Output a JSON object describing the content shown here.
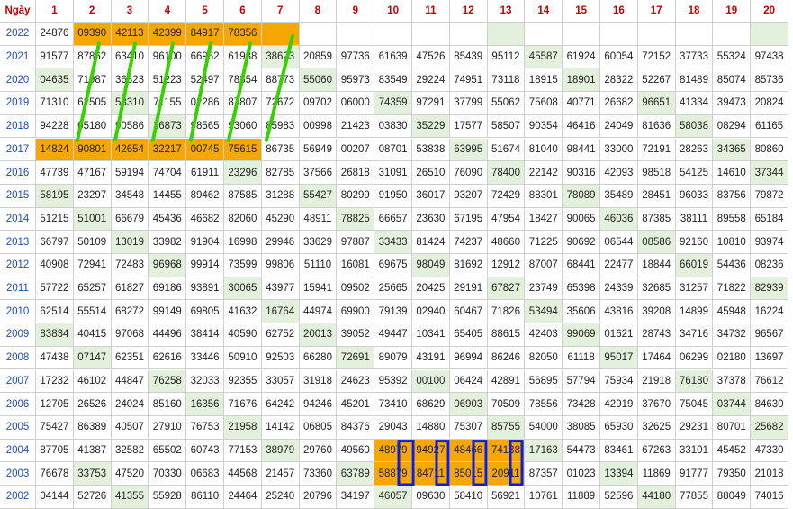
{
  "header": {
    "corner_label": "Ngày",
    "days": [
      "1",
      "2",
      "3",
      "4",
      "5",
      "6",
      "7",
      "8",
      "9",
      "10",
      "11",
      "12",
      "13",
      "14",
      "15",
      "16",
      "17",
      "18",
      "19",
      "20"
    ]
  },
  "colors": {
    "highlight_orange": "#f6a800",
    "tint_green": "#e3f1dc",
    "diagonal_line_green": "#39d000",
    "box_outline_blue": "#0a1ee6",
    "header_red": "#c00000",
    "year_blue": "#1f4fb5"
  },
  "rows": [
    {
      "year": "2022",
      "values": [
        "24876",
        "09390",
        "42113",
        "42399",
        "84917",
        "78356",
        "",
        "",
        "",
        "",
        "",
        "",
        "",
        "",
        "",
        "",
        "",
        "",
        "",
        ""
      ],
      "orange": [
        1,
        2,
        3,
        4,
        5,
        6
      ],
      "green": [
        12,
        19
      ]
    },
    {
      "year": "2021",
      "values": [
        "91577",
        "87862",
        "63410",
        "96100",
        "66962",
        "61938",
        "38623",
        "20859",
        "97736",
        "61639",
        "47526",
        "85439",
        "95112",
        "45587",
        "61924",
        "60054",
        "72152",
        "37733",
        "55324",
        "97438"
      ],
      "orange": [],
      "green": [
        6,
        13
      ]
    },
    {
      "year": "2020",
      "values": [
        "04635",
        "71987",
        "36823",
        "51223",
        "52497",
        "78354",
        "88773",
        "55060",
        "95973",
        "83549",
        "29224",
        "74951",
        "73118",
        "18915",
        "18901",
        "28322",
        "52267",
        "81489",
        "85074",
        "85736"
      ],
      "orange": [],
      "green": [
        0,
        7,
        14
      ]
    },
    {
      "year": "2019",
      "values": [
        "71310",
        "62505",
        "58310",
        "71155",
        "02286",
        "87807",
        "72672",
        "09702",
        "06000",
        "74359",
        "97291",
        "37799",
        "55062",
        "75608",
        "40771",
        "26682",
        "96651",
        "41334",
        "39473",
        "20824"
      ],
      "orange": [],
      "green": [
        2,
        9,
        16
      ]
    },
    {
      "year": "2018",
      "values": [
        "94228",
        "05180",
        "90586",
        "16873",
        "98565",
        "93060",
        "85983",
        "00998",
        "21423",
        "03830",
        "35229",
        "17577",
        "58507",
        "90354",
        "46416",
        "24049",
        "81636",
        "58038",
        "08294",
        "61165"
      ],
      "orange": [],
      "green": [
        3,
        10,
        17
      ]
    },
    {
      "year": "2017",
      "values": [
        "14824",
        "90801",
        "42654",
        "32217",
        "00745",
        "75615",
        "86735",
        "56949",
        "00207",
        "08701",
        "53838",
        "63995",
        "51674",
        "81040",
        "98441",
        "33000",
        "72191",
        "28263",
        "34365",
        "80860"
      ],
      "orange": [
        0,
        1,
        2,
        3,
        4,
        5
      ],
      "green": [
        11,
        18
      ]
    },
    {
      "year": "2016",
      "values": [
        "47739",
        "47167",
        "59194",
        "74704",
        "61911",
        "23296",
        "82785",
        "37566",
        "26818",
        "31091",
        "26510",
        "76090",
        "78400",
        "22142",
        "90316",
        "42093",
        "98518",
        "54125",
        "14610",
        "37344"
      ],
      "orange": [],
      "green": [
        5,
        12,
        19
      ]
    },
    {
      "year": "2015",
      "values": [
        "58195",
        "23297",
        "34548",
        "14455",
        "89462",
        "87585",
        "31288",
        "55427",
        "80299",
        "91950",
        "36017",
        "93207",
        "72429",
        "88301",
        "78089",
        "35489",
        "28451",
        "96033",
        "83756",
        "79872"
      ],
      "orange": [],
      "green": [
        0,
        7,
        14
      ]
    },
    {
      "year": "2014",
      "values": [
        "51215",
        "51001",
        "66679",
        "45436",
        "46682",
        "82060",
        "45290",
        "48911",
        "78825",
        "66657",
        "23630",
        "67195",
        "47954",
        "18427",
        "90065",
        "46036",
        "87385",
        "38111",
        "89558",
        "65184"
      ],
      "orange": [],
      "green": [
        1,
        8,
        15
      ]
    },
    {
      "year": "2013",
      "values": [
        "66797",
        "50109",
        "13019",
        "33982",
        "91904",
        "16998",
        "29946",
        "33629",
        "97887",
        "33433",
        "81424",
        "74237",
        "48660",
        "71225",
        "90692",
        "06544",
        "08586",
        "92160",
        "10810",
        "93974"
      ],
      "orange": [],
      "green": [
        2,
        9,
        16
      ]
    },
    {
      "year": "2012",
      "values": [
        "40908",
        "72941",
        "72483",
        "96968",
        "99914",
        "73599",
        "99806",
        "51110",
        "16081",
        "69675",
        "98049",
        "81692",
        "12912",
        "87007",
        "68441",
        "22477",
        "18844",
        "66019",
        "54436",
        "08236"
      ],
      "orange": [],
      "green": [
        3,
        10,
        17
      ]
    },
    {
      "year": "2011",
      "values": [
        "57722",
        "65257",
        "61827",
        "69186",
        "93891",
        "30065",
        "43977",
        "15941",
        "09502",
        "25665",
        "20425",
        "29191",
        "67827",
        "23749",
        "65398",
        "24339",
        "32685",
        "31257",
        "71822",
        "82939"
      ],
      "orange": [],
      "green": [
        5,
        12,
        19
      ]
    },
    {
      "year": "2010",
      "values": [
        "62514",
        "55514",
        "68272",
        "99149",
        "69805",
        "41632",
        "16764",
        "44974",
        "69900",
        "79139",
        "02940",
        "60467",
        "71826",
        "53494",
        "35606",
        "43816",
        "39208",
        "14899",
        "45948",
        "16224"
      ],
      "orange": [],
      "green": [
        6,
        13
      ]
    },
    {
      "year": "2009",
      "values": [
        "83834",
        "40415",
        "97068",
        "44496",
        "38414",
        "40590",
        "62752",
        "20013",
        "39052",
        "49447",
        "10341",
        "65405",
        "88615",
        "42403",
        "99069",
        "01621",
        "28743",
        "34716",
        "34732",
        "96567"
      ],
      "orange": [],
      "green": [
        0,
        7,
        14
      ]
    },
    {
      "year": "2008",
      "values": [
        "47438",
        "07147",
        "62351",
        "62616",
        "33446",
        "50910",
        "92503",
        "66280",
        "72691",
        "89079",
        "43191",
        "96994",
        "86246",
        "82050",
        "61118",
        "95017",
        "17464",
        "06299",
        "02180",
        "13697"
      ],
      "orange": [],
      "green": [
        1,
        8,
        15
      ]
    },
    {
      "year": "2007",
      "values": [
        "17232",
        "46102",
        "44847",
        "76258",
        "32033",
        "92355",
        "33057",
        "31918",
        "24623",
        "95392",
        "00100",
        "06424",
        "42891",
        "56895",
        "57794",
        "75934",
        "21918",
        "76180",
        "37378",
        "76612"
      ],
      "orange": [],
      "green": [
        3,
        10,
        17
      ]
    },
    {
      "year": "2006",
      "values": [
        "12705",
        "26526",
        "24024",
        "85160",
        "16356",
        "71676",
        "64242",
        "94246",
        "45201",
        "73410",
        "68629",
        "06903",
        "70509",
        "78556",
        "73428",
        "42919",
        "37670",
        "75045",
        "03744",
        "84630"
      ],
      "orange": [],
      "green": [
        4,
        11,
        18
      ]
    },
    {
      "year": "2005",
      "values": [
        "75427",
        "86389",
        "40507",
        "27910",
        "76753",
        "21958",
        "14142",
        "06805",
        "84376",
        "29043",
        "14880",
        "75307",
        "85755",
        "54000",
        "38085",
        "65930",
        "32625",
        "29231",
        "80701",
        "25682"
      ],
      "orange": [],
      "green": [
        5,
        12,
        19
      ]
    },
    {
      "year": "2004",
      "values": [
        "87705",
        "41387",
        "32582",
        "65502",
        "60743",
        "77153",
        "38979",
        "29760",
        "49560",
        "48979",
        "94927",
        "48466",
        "74138",
        "17163",
        "54473",
        "83461",
        "67263",
        "33101",
        "45452",
        "47330"
      ],
      "orange": [
        9,
        10,
        11,
        12
      ],
      "green": [
        6,
        13
      ]
    },
    {
      "year": "2003",
      "values": [
        "76678",
        "33753",
        "47520",
        "70330",
        "06683",
        "44568",
        "21457",
        "73360",
        "63789",
        "58879",
        "84711",
        "85015",
        "20911",
        "87357",
        "01023",
        "13394",
        "11869",
        "91777",
        "79350",
        "21018"
      ],
      "orange": [
        9,
        10,
        11,
        12
      ],
      "green": [
        1,
        8,
        15
      ]
    },
    {
      "year": "2002",
      "values": [
        "04144",
        "52726",
        "41355",
        "55928",
        "86110",
        "24464",
        "25240",
        "20796",
        "34197",
        "46057",
        "09630",
        "58410",
        "56921",
        "10761",
        "11889",
        "52596",
        "44180",
        "77855",
        "88049",
        "74016"
      ],
      "orange": [],
      "green": [
        2,
        9,
        16
      ]
    }
  ]
}
